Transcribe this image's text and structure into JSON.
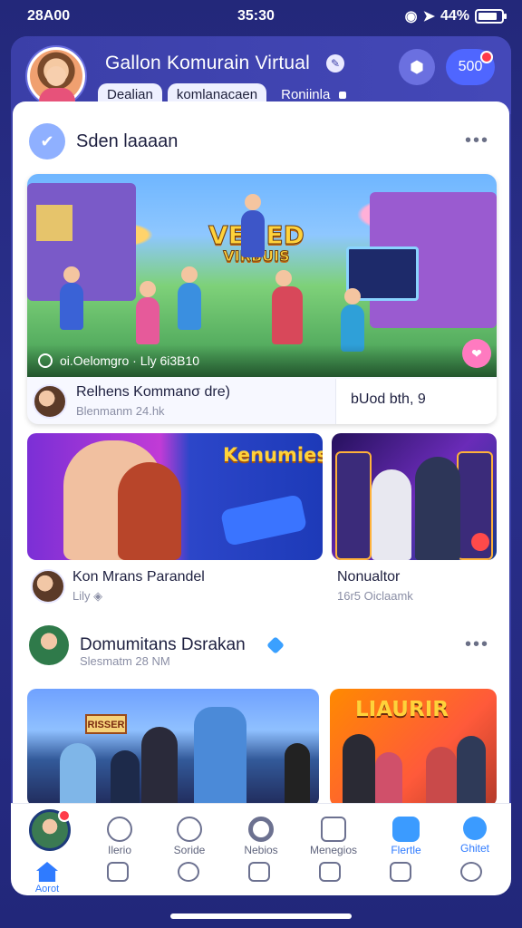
{
  "status_bar": {
    "carrier": "28A00",
    "time": "35:30",
    "battery_text": "44%",
    "icons": [
      "location-icon",
      "signal-icon",
      "battery-icon"
    ]
  },
  "header": {
    "title": "Gallon Komurain Virtual",
    "tabs": [
      {
        "label": "Dealian"
      },
      {
        "label": "komlanacaen"
      },
      {
        "label": "Roniinla"
      }
    ],
    "count_badge": "500",
    "accent": "#4448b8"
  },
  "feed": {
    "section1_title": "Sden laaaan",
    "hero": {
      "logo_line1": "VEUED",
      "logo_line2": "VIRBUIS",
      "caption": "oi.Oelomgro · Lly 6i3B10",
      "author": "Relhens Kommanσ dre)",
      "author_meta": "Blenmanm 24.hk",
      "stat": "bUod bth, 9"
    },
    "tiles": [
      {
        "logo": "Kenumies",
        "name": "Kon Mrans Parandel",
        "meta": "Lily"
      },
      {
        "name": "Nonualtor",
        "meta": "16r5 Oiclaamk"
      }
    ],
    "section2": {
      "title": "Domumitans Dsrakan",
      "meta": "Slesmatm 28 NM",
      "tile_sign_left": "RISSER",
      "tile_sign_right": "LIAURIR"
    }
  },
  "tabbar": {
    "top": [
      {
        "label": "Ilerio",
        "icon": "pin-icon"
      },
      {
        "label": "Soride",
        "icon": "person-icon"
      },
      {
        "label": "Nebios",
        "icon": "circle-icon"
      },
      {
        "label": "Menegios",
        "icon": "message-icon"
      },
      {
        "label": "Flertle",
        "icon": "gallery-icon"
      },
      {
        "label": "Ghitet",
        "icon": "profile-icon"
      }
    ],
    "bottom": [
      {
        "label": "Aorot",
        "icon": "home-icon"
      },
      {
        "label": "",
        "icon": "photo-icon"
      },
      {
        "label": "",
        "icon": "search-icon"
      },
      {
        "label": "",
        "icon": "grid-icon"
      },
      {
        "label": "",
        "icon": "clock-icon"
      },
      {
        "label": "",
        "icon": "calendar-icon"
      },
      {
        "label": "",
        "icon": "user-icon"
      }
    ]
  }
}
